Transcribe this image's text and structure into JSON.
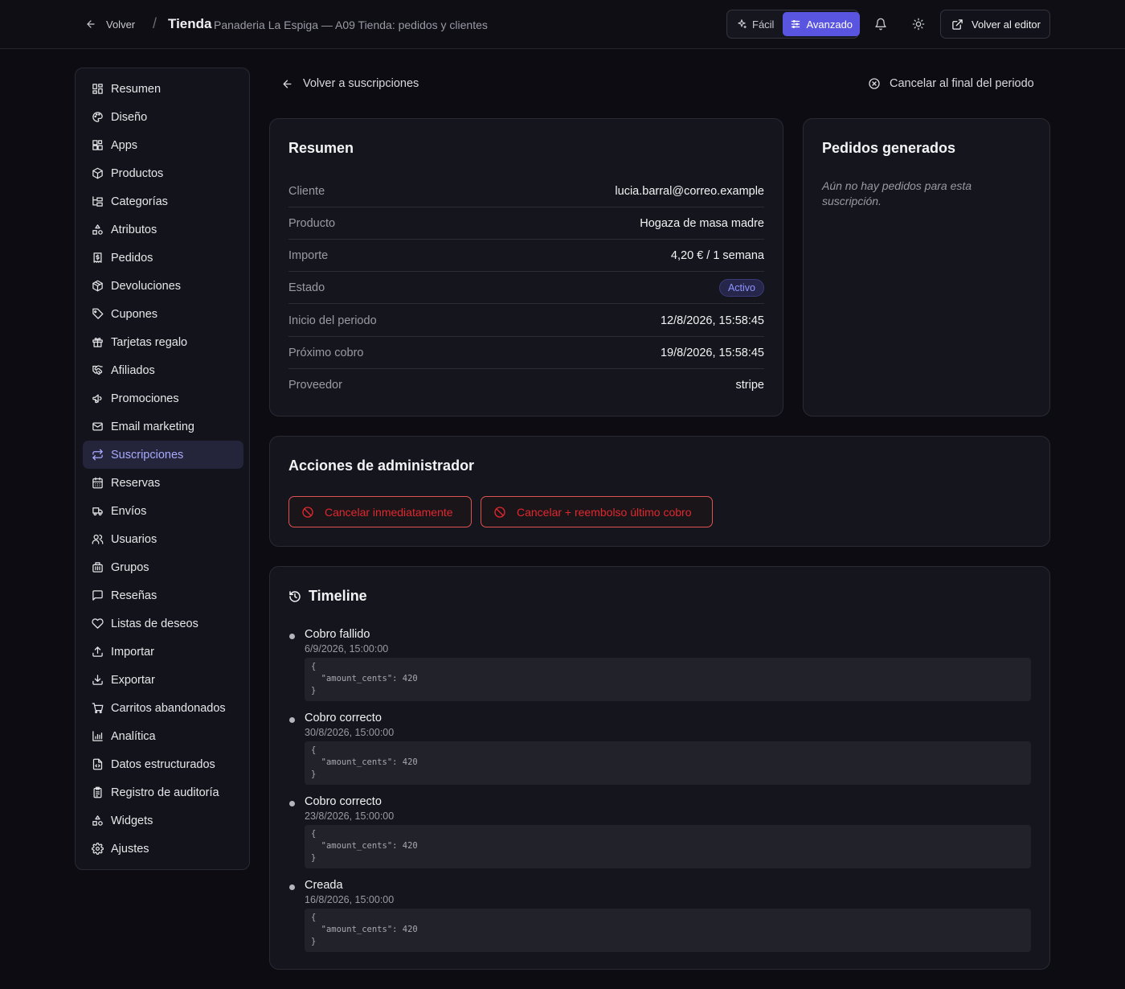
{
  "topbar": {
    "back_label": "Volver",
    "separator": "/",
    "title": "Tienda",
    "subtitle": "Panaderia La Espiga — A09 Tienda: pedidos y clientes",
    "mode_easy": "Fácil",
    "mode_advanced": "Avanzado",
    "active_mode": "Avanzado",
    "editor_label": "Volver al editor"
  },
  "sidebar": {
    "active": "Suscripciones",
    "items": [
      {
        "label": "Resumen",
        "icon": "dashboard-icon"
      },
      {
        "label": "Diseño",
        "icon": "palette-icon"
      },
      {
        "label": "Apps",
        "icon": "apps-icon"
      },
      {
        "label": "Productos",
        "icon": "package-icon"
      },
      {
        "label": "Categorías",
        "icon": "tree-icon"
      },
      {
        "label": "Atributos",
        "icon": "shapes-icon"
      },
      {
        "label": "Pedidos",
        "icon": "receipt-icon"
      },
      {
        "label": "Devoluciones",
        "icon": "package-return-icon"
      },
      {
        "label": "Cupones",
        "icon": "tag-icon"
      },
      {
        "label": "Tarjetas regalo",
        "icon": "gift-icon"
      },
      {
        "label": "Afiliados",
        "icon": "handshake-icon"
      },
      {
        "label": "Promociones",
        "icon": "megaphone-icon"
      },
      {
        "label": "Email marketing",
        "icon": "mail-icon"
      },
      {
        "label": "Suscripciones",
        "icon": "repeat-icon"
      },
      {
        "label": "Reservas",
        "icon": "calendar-icon"
      },
      {
        "label": "Envíos",
        "icon": "truck-icon"
      },
      {
        "label": "Usuarios",
        "icon": "users-icon"
      },
      {
        "label": "Grupos",
        "icon": "building-icon"
      },
      {
        "label": "Reseñas",
        "icon": "message-square-icon"
      },
      {
        "label": "Listas de deseos",
        "icon": "heart-icon"
      },
      {
        "label": "Importar",
        "icon": "upload-icon"
      },
      {
        "label": "Exportar",
        "icon": "download-icon"
      },
      {
        "label": "Carritos abandonados",
        "icon": "cart-icon"
      },
      {
        "label": "Analítica",
        "icon": "bar-chart-icon"
      },
      {
        "label": "Datos estructurados",
        "icon": "file-code-icon"
      },
      {
        "label": "Registro de auditoría",
        "icon": "clipboard-list-icon"
      },
      {
        "label": "Widgets",
        "icon": "shapes-icon"
      },
      {
        "label": "Ajustes",
        "icon": "settings-icon"
      }
    ]
  },
  "subheader": {
    "back_label": "Volver a suscripciones",
    "cancel_end_label": "Cancelar al final del periodo"
  },
  "summary": {
    "title": "Resumen",
    "rows": [
      {
        "key": "Cliente",
        "value": "lucia.barral@correo.example"
      },
      {
        "key": "Producto",
        "value": "Hogaza de masa madre"
      },
      {
        "key": "Importe",
        "value": "4,20 € / 1 semana"
      },
      {
        "key": "Estado",
        "value": "Activo",
        "badge": true
      },
      {
        "key": "Inicio del periodo",
        "value": "12/8/2026, 15:58:45"
      },
      {
        "key": "Próximo cobro",
        "value": "19/8/2026, 15:58:45"
      },
      {
        "key": "Proveedor",
        "value": "stripe"
      }
    ]
  },
  "orders": {
    "title": "Pedidos generados",
    "empty": "Aún no hay pedidos para esta suscripción."
  },
  "admin": {
    "title": "Acciones de administrador",
    "cancel_now": "Cancelar inmediatamente",
    "cancel_refund": "Cancelar + reembolso último cobro"
  },
  "timeline": {
    "title": "Timeline",
    "events": [
      {
        "title": "Cobro fallido",
        "date": "6/9/2026, 15:00:00",
        "json": "{\n  \"amount_cents\": 420\n}"
      },
      {
        "title": "Cobro correcto",
        "date": "30/8/2026, 15:00:00",
        "json": "{\n  \"amount_cents\": 420\n}"
      },
      {
        "title": "Cobro correcto",
        "date": "23/8/2026, 15:00:00",
        "json": "{\n  \"amount_cents\": 420\n}"
      },
      {
        "title": "Creada",
        "date": "16/8/2026, 15:00:00",
        "json": "{\n  \"amount_cents\": 420\n}"
      }
    ]
  },
  "colors": {
    "background": "#0c0c12",
    "card": "#15151d",
    "accent": "#5a55e0",
    "active_text": "#a9abff",
    "danger": "#e0282f"
  }
}
